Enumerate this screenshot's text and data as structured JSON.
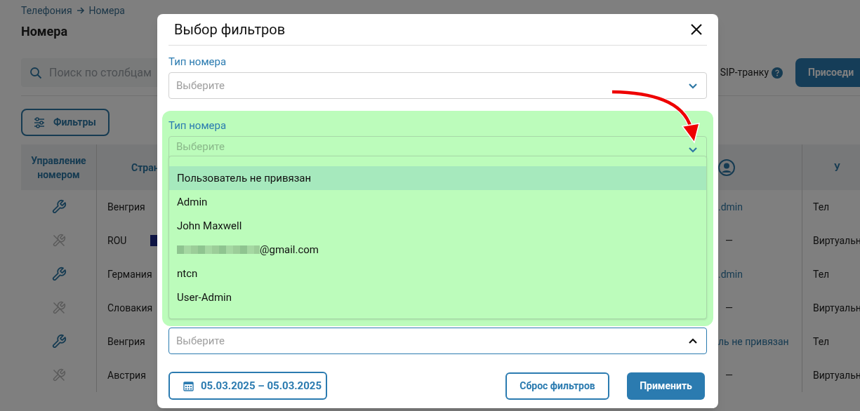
{
  "breadcrumb": [
    "Телефония",
    "Номера"
  ],
  "page_title": "Номера",
  "search": {
    "placeholder": "Поиск по столбцам"
  },
  "sip_label": "SIP-транку",
  "connect_button": "Присоеди",
  "filters_button": "Фильтры",
  "table": {
    "columns": [
      {
        "label": "Управление номером"
      },
      {
        "label": "Стран"
      },
      {
        "kind": "user-icon"
      },
      {
        "label": "У"
      }
    ],
    "rows": [
      {
        "manage_enabled": true,
        "country": "Венгрия",
        "flag": false,
        "user": ".dmin",
        "kind": "link",
        "type": "Тел"
      },
      {
        "manage_enabled": false,
        "country": "ROU",
        "flag": true,
        "user": "—",
        "kind": "plain",
        "type": "Виртуальн"
      },
      {
        "manage_enabled": true,
        "country": "Германия",
        "flag": false,
        "user": ".dmin",
        "kind": "link",
        "type": "Тел"
      },
      {
        "manage_enabled": false,
        "country": "Словакия",
        "flag": false,
        "user": "—",
        "kind": "plain",
        "type": "Виртуальн"
      },
      {
        "manage_enabled": true,
        "country": "Венгрия",
        "flag": false,
        "user": "ль не привязан",
        "kind": "link",
        "type": "Тел"
      },
      {
        "manage_enabled": false,
        "country": "Австрия",
        "flag": false,
        "user": "—",
        "kind": "plain",
        "type": "Виртуальн"
      }
    ]
  },
  "modal": {
    "title": "Выбор фильтров",
    "filters": [
      {
        "label": "Тип номера",
        "placeholder": "Выберите",
        "highlighted": false,
        "expanded": false
      },
      {
        "label": "Тип номера",
        "placeholder": "Выберите",
        "highlighted": true,
        "expanded": false,
        "options": [
          {
            "label": "Пользователь не привязан",
            "selected": true,
            "kind": "text"
          },
          {
            "label": "Admin",
            "selected": false,
            "kind": "text"
          },
          {
            "label": "John Maxwell",
            "selected": false,
            "kind": "text"
          },
          {
            "label": "@gmail.com",
            "selected": false,
            "kind": "redacted"
          },
          {
            "label": "ntcn",
            "selected": false,
            "kind": "text"
          },
          {
            "label": "User-Admin",
            "selected": false,
            "kind": "text"
          }
        ]
      },
      {
        "placeholder": "Выберите",
        "highlighted": false,
        "expanded": true
      }
    ],
    "date_button": "05.03.2025 – 05.03.2025",
    "reset_button": "Сброс фильтров",
    "apply_button": "Применить"
  }
}
